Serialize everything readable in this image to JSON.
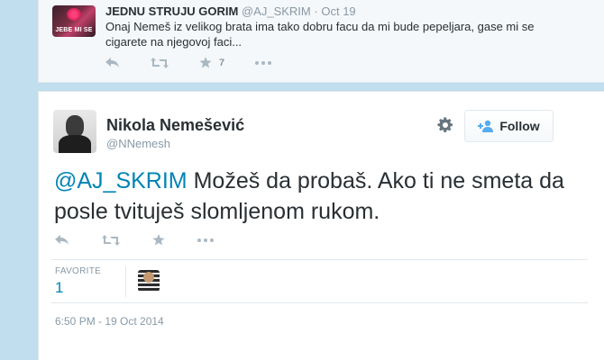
{
  "parent_tweet": {
    "avatar_text": "JEBE MI SE",
    "fullname": "JEDNU STRUJU GORIM",
    "username": "@AJ_SKRIM",
    "separator": "·",
    "time": "Oct 19",
    "text": "Onaj Nemeš iz velikog brata ima tako dobru facu da mi bude pepeljara, gase mi se cigarete na njegovoj faci...",
    "actions": {
      "reply_icon": "reply-icon",
      "retweet_icon": "retweet-icon",
      "favorite_icon": "star-icon",
      "favorite_count": "7",
      "more_icon": "more-icon"
    }
  },
  "main_tweet": {
    "fullname": "Nikola Nemešević",
    "username": "@NNemesh",
    "follow_label": "Follow",
    "mention": "@AJ_SKRIM",
    "text": " Možeš da probaš. Ako ti ne smeta da posle tvituješ slomljenom rukom.",
    "stats": {
      "favorites_label": "FAVORITE",
      "favorites_count": "1"
    },
    "timestamp": "6:50 PM - 19 Oct 2014"
  },
  "colors": {
    "page_background": "#c0deed",
    "link": "#0084b4",
    "muted": "#8899a6",
    "action_icon": "#aab8c2"
  }
}
